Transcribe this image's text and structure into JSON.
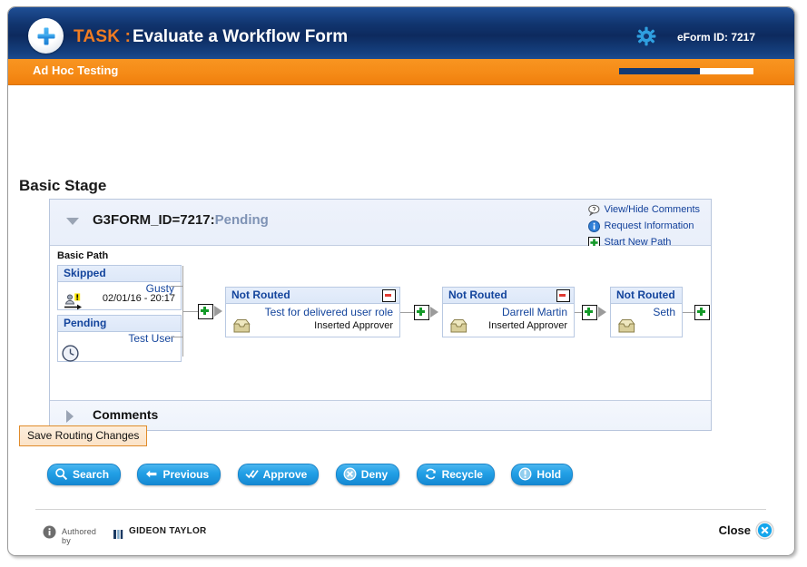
{
  "header": {
    "plus_icon": "plus-circle-icon",
    "task_label": "TASK :",
    "task_title": "Evaluate a Workflow Form",
    "gear_icon": "gear-icon",
    "eform_id": "eForm ID: 7217",
    "accent_orange": "#f07c22",
    "bar_navy": "#123a74"
  },
  "subbar": {
    "title": "Ad Hoc Testing",
    "progress_percent": 60
  },
  "stage": {
    "title": "Basic Stage",
    "panel_title_prefix": "G3FORM_ID=7217:",
    "panel_title_status": "Pending",
    "path_label": "Basic Path",
    "links": [
      {
        "label": "View/Hide Comments",
        "icon": "comment-bubble-icon"
      },
      {
        "label": "Request Information",
        "icon": "info-circle-icon"
      },
      {
        "label": "Start New Path",
        "icon": "green-plus-icon"
      }
    ]
  },
  "nodes": [
    {
      "status": "Skipped",
      "person": "Gusty",
      "subtitle": "",
      "date": "02/01/16 - 20:17",
      "icon": "user-skipped-icon",
      "has_remove": false
    },
    {
      "status": "Pending",
      "person": "Test User",
      "subtitle": "",
      "date": "",
      "icon": "clock-icon",
      "has_remove": false
    },
    {
      "status": "Not Routed",
      "person": "Test for delivered user role",
      "subtitle": "Inserted Approver",
      "date": "",
      "icon": "inbox-icon",
      "has_remove": true
    },
    {
      "status": "Not Routed",
      "person": "Darrell Martin",
      "subtitle": "Inserted Approver",
      "date": "",
      "icon": "inbox-icon",
      "has_remove": true
    },
    {
      "status": "Not Routed",
      "person": "Seth",
      "subtitle": "",
      "date": "",
      "icon": "inbox-icon",
      "has_remove": false
    }
  ],
  "comments": {
    "label": "Comments",
    "expanded": false
  },
  "save": {
    "label": "Save Routing Changes"
  },
  "actions": [
    {
      "label": "Search",
      "icon": "magnifier-icon"
    },
    {
      "label": "Previous",
      "icon": "arrow-left-icon"
    },
    {
      "label": "Approve",
      "icon": "double-check-icon"
    },
    {
      "label": "Deny",
      "icon": "circle-x-icon"
    },
    {
      "label": "Recycle",
      "icon": "recycle-icon"
    },
    {
      "label": "Hold",
      "icon": "exclamation-circle-icon"
    }
  ],
  "footer": {
    "info_icon": "info-icon",
    "authored_by": "Authored by",
    "vendor": "GIDEON TAYLOR",
    "close_label": "Close",
    "close_icon": "close-circle-icon"
  }
}
